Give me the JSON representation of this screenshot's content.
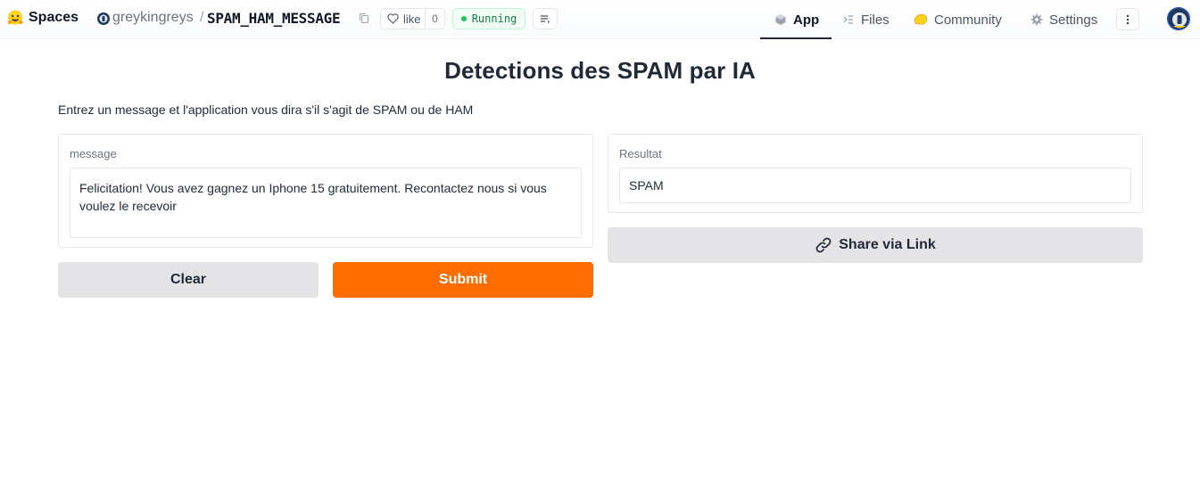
{
  "header": {
    "brand_label": "Spaces",
    "owner": "greykingreys",
    "separator": "/",
    "space_name": "SPAM_HAM_MESSAGE",
    "like_label": "like",
    "like_count": "0",
    "status": "Running",
    "tabs": [
      {
        "label": "App",
        "icon": "cube-icon",
        "active": true
      },
      {
        "label": "Files",
        "icon": "files-icon",
        "active": false
      },
      {
        "label": "Community",
        "icon": "community-icon",
        "active": false
      },
      {
        "label": "Settings",
        "icon": "gear-icon",
        "active": false
      }
    ]
  },
  "main": {
    "title": "Detections des SPAM par IA",
    "description": "Entrez un message et l'application vous dira s'il s'agit de SPAM ou de HAM",
    "input": {
      "label": "message",
      "value": "Felicitation! Vous avez gagnez un Iphone 15 gratuitement. Recontactez nous si vous voulez le recevoir"
    },
    "output": {
      "label": "Resultat",
      "value": "SPAM"
    },
    "buttons": {
      "clear": "Clear",
      "submit": "Submit",
      "share": "Share via Link"
    }
  },
  "colors": {
    "primary_button": "#ff6d00",
    "secondary_button": "#e4e4e7",
    "status_green": "#22c55e"
  }
}
